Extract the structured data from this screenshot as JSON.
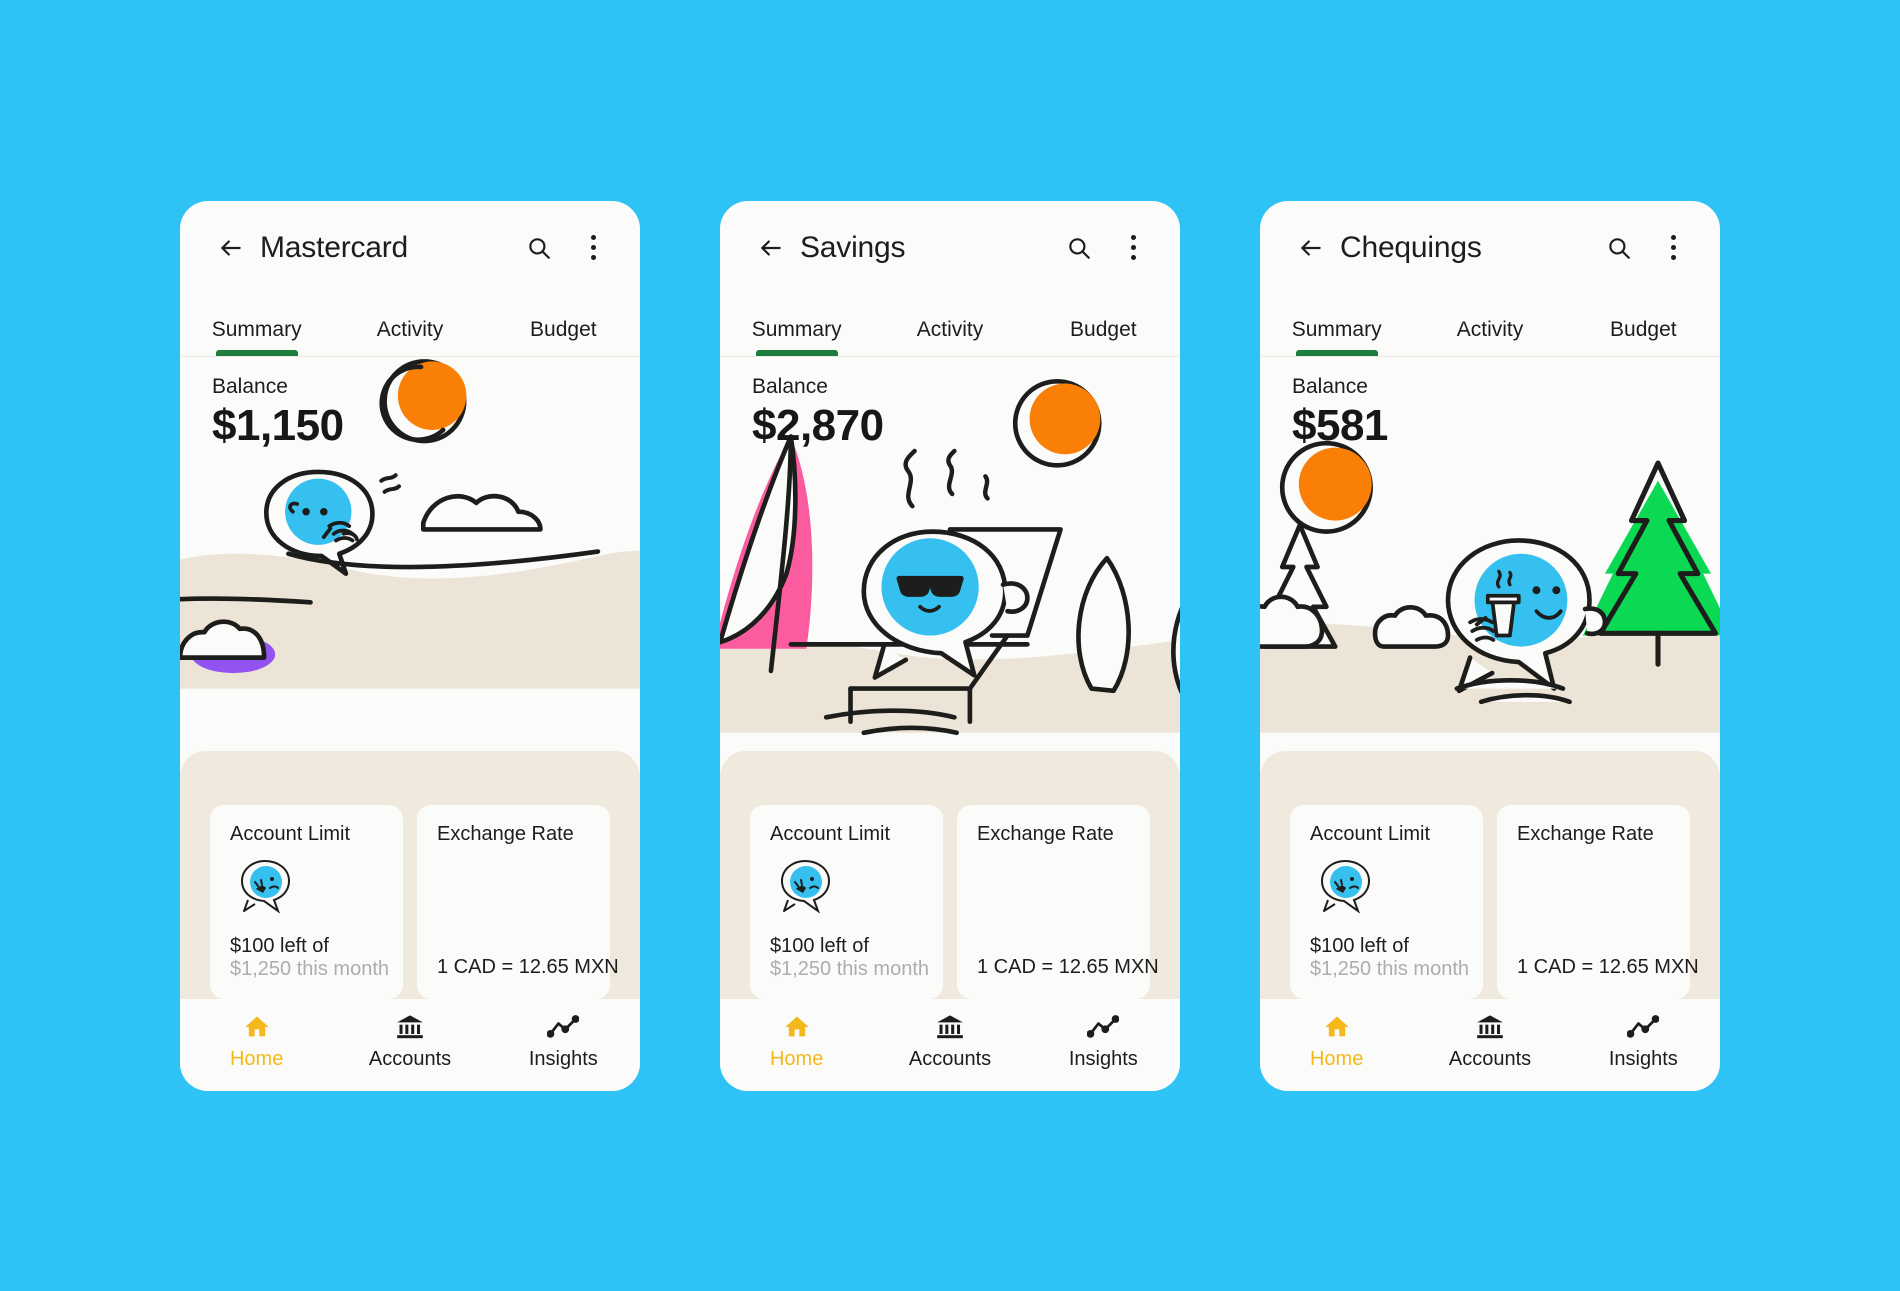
{
  "canvas": {
    "background_color": "#2ec2f5"
  },
  "theme": {
    "card_background": "#fbfbfa",
    "info_strip_background": "#f0e9dd",
    "active_tab_underline": "#1b7f3b",
    "active_nav_color": "#f5b81b",
    "sun_color": "#f97f06",
    "character_color": "#35c0f0",
    "sand_color": "#ece4d6",
    "umbrella_color": "#fb5ca0",
    "tree_color": "#0bd954",
    "cloud_accent_color": "#9353f0",
    "muted_text_color": "#adadad"
  },
  "screens": [
    {
      "id": "mastercard",
      "appbar": {
        "back_icon": "arrow-left-icon",
        "title": "Mastercard",
        "search_icon": "search-icon",
        "overflow_icon": "more-vertical-icon"
      },
      "tabs": [
        {
          "label": "Summary",
          "active": true
        },
        {
          "label": "Activity",
          "active": false
        },
        {
          "label": "Budget",
          "active": false
        }
      ],
      "balance": {
        "label": "Balance",
        "value": "$1,150"
      },
      "illustration": "character-lying-on-sand-with-cloud",
      "info_cards": [
        {
          "title": "Account Limit",
          "icon": "worried-character-icon",
          "main": "$100 left of",
          "sub": "$1,250 this month"
        },
        {
          "title": "Exchange Rate",
          "value": "1 CAD = 12.65 MXN"
        }
      ],
      "bottom_nav": [
        {
          "label": "Home",
          "icon": "home-icon",
          "active": true
        },
        {
          "label": "Accounts",
          "icon": "bank-icon",
          "active": false
        },
        {
          "label": "Insights",
          "icon": "trend-chart-icon",
          "active": false
        }
      ]
    },
    {
      "id": "savings",
      "appbar": {
        "back_icon": "arrow-left-icon",
        "title": "Savings",
        "search_icon": "search-icon",
        "overflow_icon": "more-vertical-icon"
      },
      "tabs": [
        {
          "label": "Summary",
          "active": true
        },
        {
          "label": "Activity",
          "active": false
        },
        {
          "label": "Budget",
          "active": false
        }
      ],
      "balance": {
        "label": "Balance",
        "value": "$2,870"
      },
      "illustration": "character-in-sunglasses-on-beach-chair-with-umbrella",
      "info_cards": [
        {
          "title": "Account Limit",
          "icon": "worried-character-icon",
          "main": "$100 left of",
          "sub": "$1,250 this month"
        },
        {
          "title": "Exchange Rate",
          "value": "1 CAD = 12.65 MXN"
        }
      ],
      "bottom_nav": [
        {
          "label": "Home",
          "icon": "home-icon",
          "active": true
        },
        {
          "label": "Accounts",
          "icon": "bank-icon",
          "active": false
        },
        {
          "label": "Insights",
          "icon": "trend-chart-icon",
          "active": false
        }
      ]
    },
    {
      "id": "chequings",
      "appbar": {
        "back_icon": "arrow-left-icon",
        "title": "Chequings",
        "search_icon": "search-icon",
        "overflow_icon": "more-vertical-icon"
      },
      "tabs": [
        {
          "label": "Summary",
          "active": true
        },
        {
          "label": "Activity",
          "active": false
        },
        {
          "label": "Budget",
          "active": false
        }
      ],
      "balance": {
        "label": "Balance",
        "value": "$581"
      },
      "illustration": "character-with-coffee-between-winter-trees",
      "info_cards": [
        {
          "title": "Account Limit",
          "icon": "worried-character-icon",
          "main": "$100 left of",
          "sub": "$1,250 this month"
        },
        {
          "title": "Exchange Rate",
          "value": "1 CAD = 12.65 MXN"
        }
      ],
      "bottom_nav": [
        {
          "label": "Home",
          "icon": "home-icon",
          "active": true
        },
        {
          "label": "Accounts",
          "icon": "bank-icon",
          "active": false
        },
        {
          "label": "Insights",
          "icon": "trend-chart-icon",
          "active": false
        }
      ]
    }
  ]
}
